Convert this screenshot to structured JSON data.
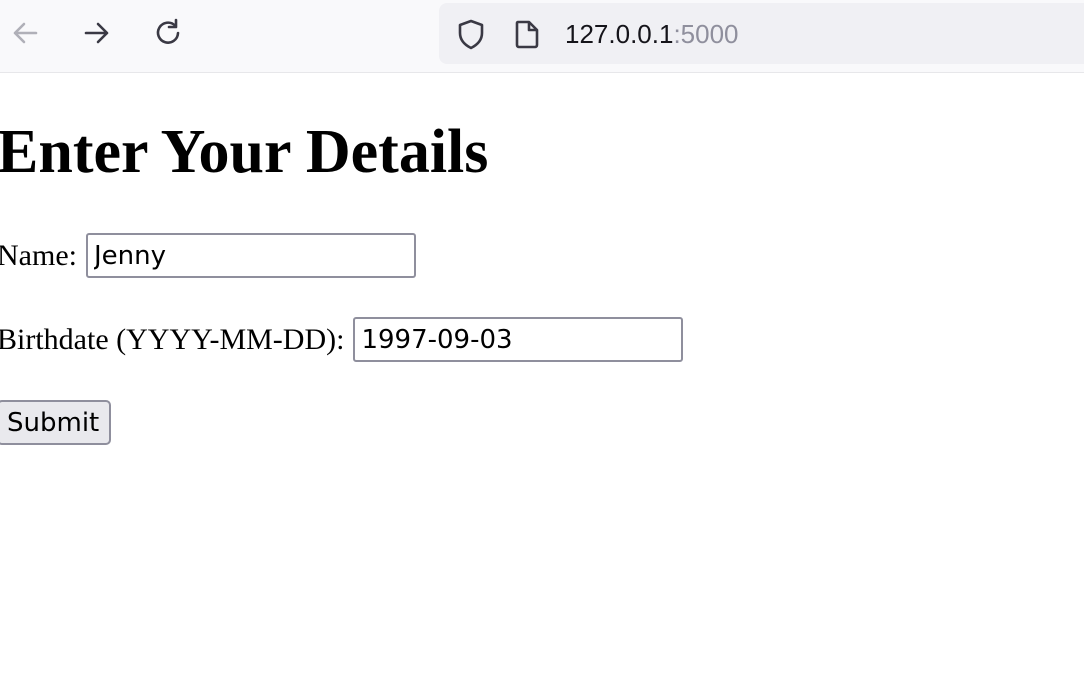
{
  "browser": {
    "url_host": "127.0.0.1",
    "url_port": ":5000",
    "icons": [
      "back-arrow-icon",
      "forward-arrow-icon",
      "reload-icon",
      "shield-icon",
      "page-icon"
    ]
  },
  "page": {
    "title": "Enter Your Details",
    "form": {
      "name_label": "Name:",
      "name_value": "Jenny",
      "birthdate_label": "Birthdate (YYYY-MM-DD):",
      "birthdate_value": "1997-09-03",
      "submit_label": "Submit"
    }
  }
}
